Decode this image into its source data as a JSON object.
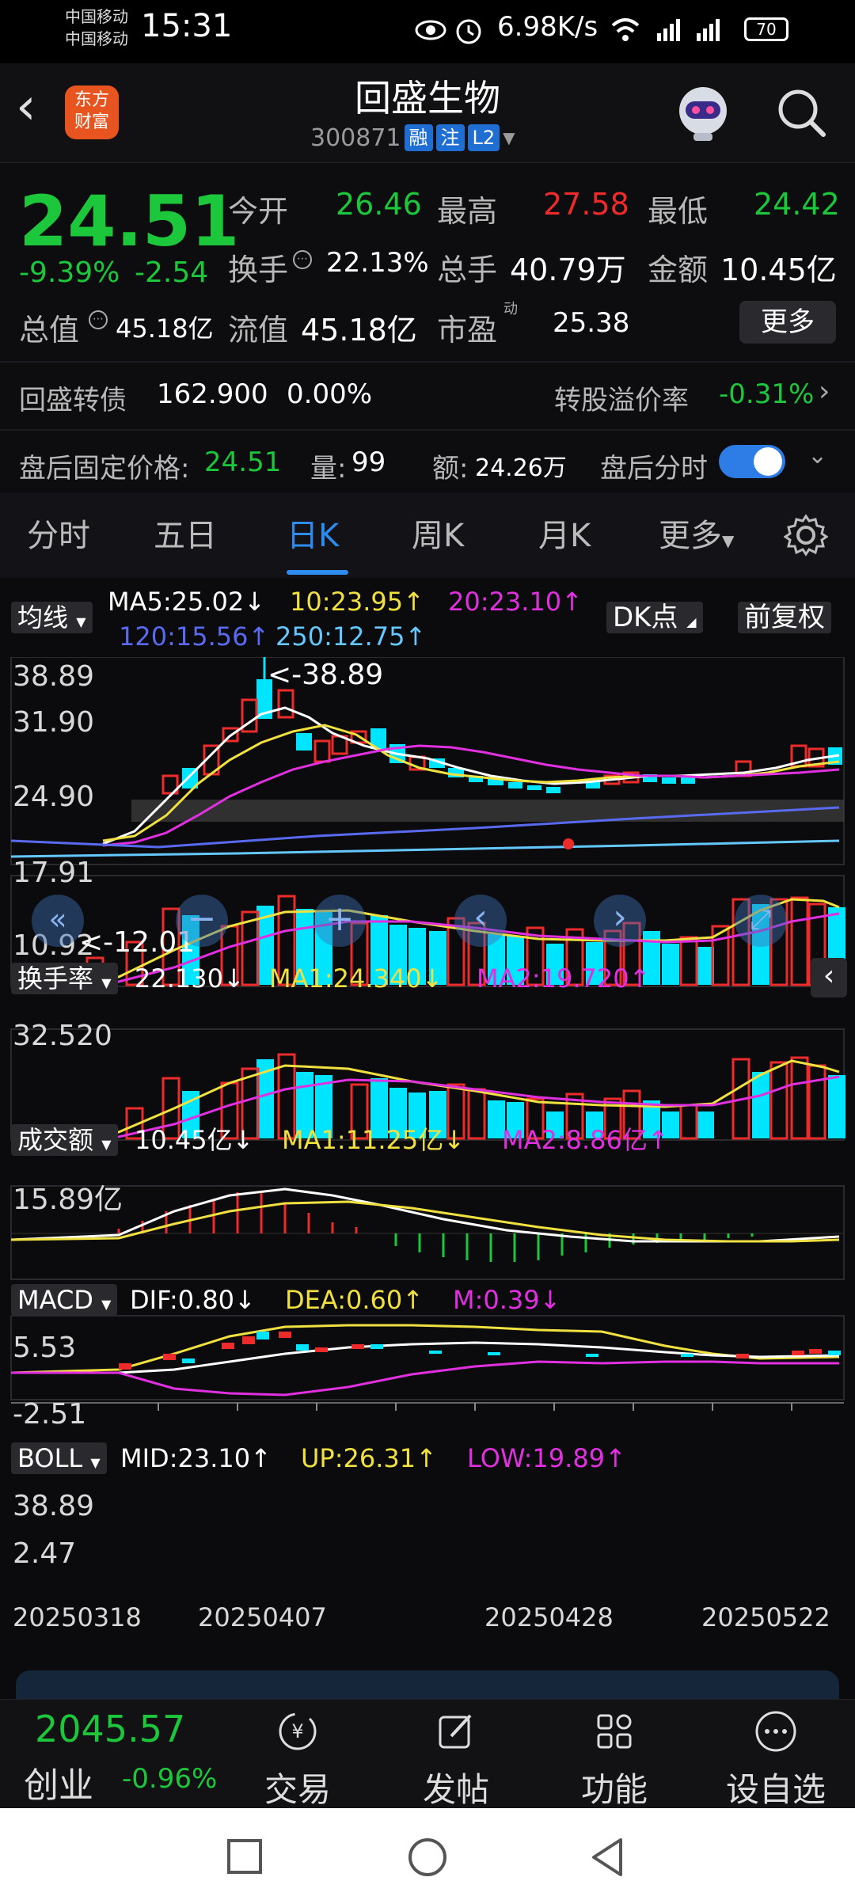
{
  "status": {
    "carrier1": "中国移动",
    "carrier2": "中国移动",
    "time": "15:31",
    "net_speed": "6.98K/s",
    "battery": "70"
  },
  "header": {
    "stock_name": "回盛生物",
    "stock_code": "300871",
    "tags": [
      "融",
      "注",
      "L2"
    ],
    "logo_line1": "东方",
    "logo_line2": "财富"
  },
  "quote": {
    "price": "24.51",
    "change_pct": "-9.39%",
    "change": "-2.54",
    "open_label": "今开",
    "open": "26.46",
    "high_label": "最高",
    "high": "27.58",
    "low_label": "最低",
    "low": "24.42",
    "turnover_label": "换手",
    "turnover": "22.13%",
    "volume_label": "总手",
    "volume": "40.79万",
    "amount_label": "金额",
    "amount": "10.45亿",
    "mktcap_label": "总值",
    "mktcap": "45.18亿",
    "float_label": "流值",
    "float": "45.18亿",
    "pe_label": "市盈",
    "pe_sup": "动",
    "pe": "25.38",
    "more_button": "更多",
    "bond_label": "回盛转债",
    "bond_price": "162.900",
    "bond_pct": "0.00%",
    "premium_label": "转股溢价率",
    "premium": "-0.31%",
    "after_label": "盘后固定价格:",
    "after_price": "24.51",
    "after_vol_label": "量:",
    "after_vol": "99",
    "after_amt_label": "额:",
    "after_amt": "24.26万",
    "after_time_label": "盘后分时"
  },
  "tabs": [
    "分时",
    "五日",
    "日K",
    "周K",
    "月K",
    "更多"
  ],
  "chart": {
    "ma_button": "均线",
    "ma5": "MA5:25.02↓",
    "ma10": "10:23.95↑",
    "ma20": "20:23.10↑",
    "ma120": "120:15.56↑",
    "ma250": "250:12.75↑",
    "dk_button": "DK点",
    "adjust_button": "前复权",
    "y_labels": [
      "38.89",
      "31.90",
      "24.90",
      "17.91",
      "10.92"
    ],
    "max_annot": "<-38.89",
    "min_annot": "<-12.01",
    "turnover_button": "换手率",
    "turnover_val": "22.130↓",
    "turnover_ma1": "MA1:24.340↓",
    "turnover_ma2": "MA2:19.720↑",
    "turnover_y": "32.520",
    "amount_button": "成交额",
    "amount_val": "10.45亿↓",
    "amount_ma1": "MA1:11.25亿↓",
    "amount_ma2": "MA2:8.86亿↑",
    "amount_y": "15.89亿",
    "macd_button": "MACD",
    "dif": "DIF:0.80↓",
    "dea": "DEA:0.60↑",
    "m": "M:0.39↓",
    "macd_y1": "5.53",
    "macd_y2": "-2.51",
    "boll_button": "BOLL",
    "mid": "MID:23.10↑",
    "up": "UP:26.31↑",
    "low": "LOW:19.89↑",
    "boll_y1": "38.89",
    "boll_y2": "2.47",
    "dates": [
      "20250318",
      "20250407",
      "20250428",
      "20250522"
    ]
  },
  "bottom_nav": {
    "index_value": "2045.57",
    "index_name": "创业",
    "index_change": "-0.96%",
    "items": [
      "交易",
      "发帖",
      "功能",
      "设自选"
    ]
  },
  "colors": {
    "up": "#ee2b2b",
    "down": "#00e5ff",
    "green": "#1dc73b",
    "accent": "#2e8cf0"
  }
}
